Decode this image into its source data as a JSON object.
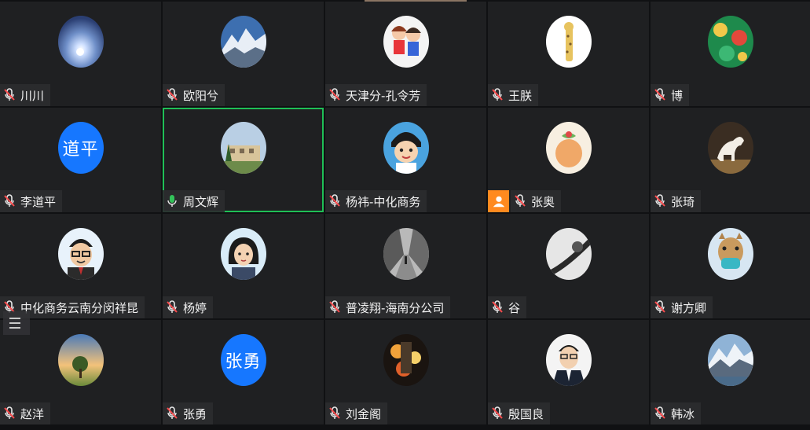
{
  "participants": [
    {
      "name": "川川",
      "mic": "muted",
      "avatar": "night-flower"
    },
    {
      "name": "欧阳兮",
      "mic": "muted",
      "avatar": "snow-mountain"
    },
    {
      "name": "天津分-孔令芳",
      "mic": "muted",
      "avatar": "cartoon-kids"
    },
    {
      "name": "王朕",
      "mic": "muted",
      "avatar": "giraffe"
    },
    {
      "name": "博",
      "mic": "muted",
      "avatar": "green-pattern"
    },
    {
      "name": "李道平",
      "mic": "muted",
      "avatar_text": "道平"
    },
    {
      "name": "周文辉",
      "mic": "speaking",
      "avatar": "building",
      "active": true
    },
    {
      "name": "杨祎-中化商务",
      "mic": "muted",
      "avatar": "anime-boy"
    },
    {
      "name": "张奥",
      "mic": "muted",
      "avatar": "egg-bird",
      "profile_badge": true
    },
    {
      "name": "张琦",
      "mic": "muted",
      "avatar": "horse"
    },
    {
      "name": "中化商务云南分闵祥昆",
      "mic": "muted",
      "avatar": "glasses-man"
    },
    {
      "name": "杨婷",
      "mic": "muted",
      "avatar": "cartoon-girl"
    },
    {
      "name": "普凌翔-海南分公司",
      "mic": "muted",
      "avatar": "street"
    },
    {
      "name": "谷",
      "mic": "muted",
      "avatar": "bw-abstract"
    },
    {
      "name": "谢方卿",
      "mic": "muted",
      "avatar": "giraffe-mask"
    },
    {
      "name": "赵洋",
      "mic": "muted",
      "avatar": "tree-sunset"
    },
    {
      "name": "张勇",
      "mic": "muted",
      "avatar_text": "张勇"
    },
    {
      "name": "刘金阁",
      "mic": "muted",
      "avatar": "fireworks"
    },
    {
      "name": "殷国良",
      "mic": "muted",
      "avatar": "man-suit"
    },
    {
      "name": "韩冰",
      "mic": "muted",
      "avatar": "mountain-lake"
    }
  ],
  "colors": {
    "active_border": "#1fbf56",
    "muted_mic": "#ff4d4f",
    "speaking_mic": "#33c25a",
    "text_avatar_bg": "#1677ff",
    "profile_badge": "#ff8a1f"
  }
}
